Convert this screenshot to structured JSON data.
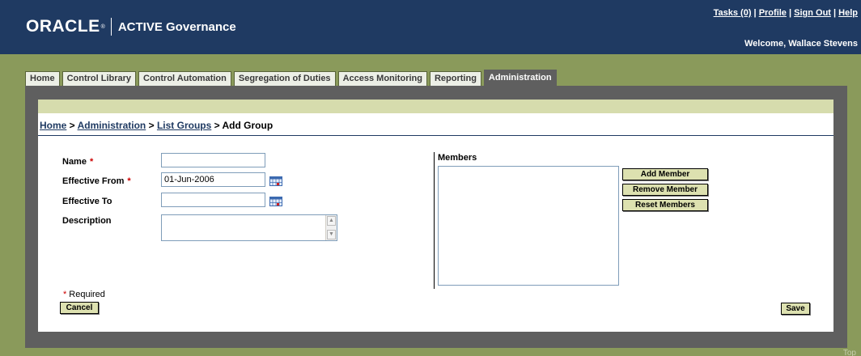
{
  "header": {
    "brand": "ORACLE",
    "reg_mark": "®",
    "product": "ACTIVE Governance",
    "links": {
      "tasks": "Tasks (0)",
      "profile": "Profile",
      "signout": "Sign Out",
      "help": "Help",
      "sep": " | "
    },
    "welcome": "Welcome, Wallace Stevens"
  },
  "tabs": [
    {
      "label": "Home"
    },
    {
      "label": "Control Library"
    },
    {
      "label": "Control Automation"
    },
    {
      "label": "Segregation of Duties"
    },
    {
      "label": "Access Monitoring"
    },
    {
      "label": "Reporting"
    },
    {
      "label": "Administration",
      "active": true
    }
  ],
  "breadcrumb": {
    "home": "Home",
    "admin": "Administration",
    "list": "List Groups",
    "current": "Add Group",
    "sep": " > "
  },
  "form": {
    "name": {
      "label": "Name",
      "value": ""
    },
    "effective_from": {
      "label": "Effective From",
      "value": "01-Jun-2006"
    },
    "effective_to": {
      "label": "Effective To",
      "value": ""
    },
    "description": {
      "label": "Description",
      "value": ""
    },
    "required_mark": "*",
    "required_note": "Required"
  },
  "members": {
    "label": "Members",
    "add_label": "Add Member",
    "remove_label": "Remove Member",
    "reset_label": "Reset Members"
  },
  "actions": {
    "cancel": "Cancel",
    "save": "Save"
  },
  "footer": {
    "top": "Top"
  },
  "colors": {
    "header_bg": "#1f3a62",
    "page_bg": "#8a9a5b",
    "frame_bg": "#5f5f5f",
    "band": "#d6dcad",
    "required": "#cc0000",
    "button_bg": "#dde1b0"
  }
}
